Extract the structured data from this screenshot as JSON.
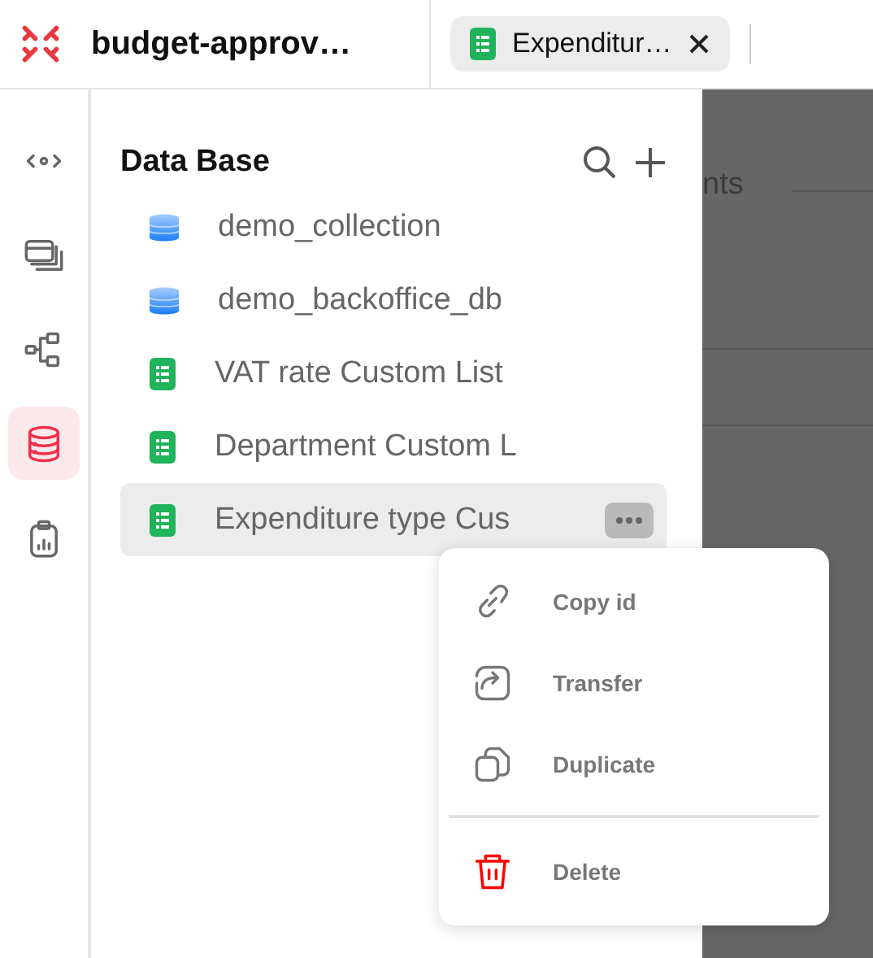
{
  "project": {
    "title": "budget-approv…"
  },
  "tabs": [
    {
      "label": "Expenditur…",
      "selected": true
    }
  ],
  "rail": [
    {
      "kind": "api",
      "selected": false
    },
    {
      "kind": "windows",
      "selected": false
    },
    {
      "kind": "flow",
      "selected": false
    },
    {
      "kind": "database",
      "selected": true
    },
    {
      "kind": "report",
      "selected": false
    }
  ],
  "panel": {
    "title": "Data Base",
    "items": [
      {
        "kind": "database",
        "label": "demo_collection",
        "selected": false
      },
      {
        "kind": "database",
        "label": "demo_backoffice_db",
        "selected": false
      },
      {
        "kind": "list",
        "label": "VAT rate Custom List",
        "selected": false
      },
      {
        "kind": "list",
        "label": "Department Custom L",
        "selected": false
      },
      {
        "kind": "list",
        "label": "Expenditure type Cus",
        "selected": true
      }
    ]
  },
  "background": {
    "text": "nts"
  },
  "menu": {
    "items": [
      {
        "kind": "link",
        "label": "Copy id"
      },
      {
        "kind": "transfer",
        "label": "Transfer"
      },
      {
        "kind": "duplicate",
        "label": "Duplicate"
      },
      {
        "kind": "delete",
        "label": "Delete"
      }
    ]
  }
}
